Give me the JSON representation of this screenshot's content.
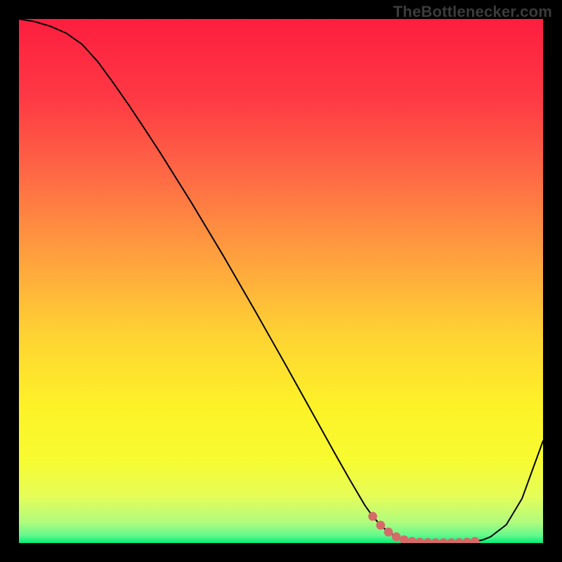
{
  "watermark": "TheBottlenecker.com",
  "chart_data": {
    "type": "line",
    "title": "",
    "xlabel": "",
    "ylabel": "",
    "xlim": [
      0,
      100
    ],
    "ylim": [
      0,
      100
    ],
    "grid": false,
    "x": [
      0,
      3,
      6,
      9,
      12,
      15,
      18,
      21,
      24,
      27,
      30,
      33,
      36,
      39,
      42,
      45,
      48,
      51,
      54,
      57,
      60,
      63,
      66,
      67.5,
      69,
      70.5,
      72,
      73.5,
      75,
      76.5,
      78,
      79.5,
      81,
      82.5,
      84,
      85.5,
      87,
      88.5,
      90,
      93,
      96,
      100
    ],
    "values": [
      100,
      99.5,
      98.6,
      97.3,
      95.2,
      91.9,
      87.8,
      83.5,
      79.0,
      74.4,
      69.6,
      64.8,
      59.8,
      54.8,
      49.6,
      44.4,
      39.1,
      33.8,
      28.4,
      23.0,
      17.6,
      12.3,
      7.2,
      5.1,
      3.4,
      2.1,
      1.2,
      0.6,
      0.3,
      0.15,
      0.08,
      0.05,
      0.05,
      0.05,
      0.08,
      0.15,
      0.3,
      0.6,
      1.2,
      3.5,
      8.5,
      19.5
    ],
    "marker_points_x": [
      67.5,
      69.0,
      70.5,
      72.0,
      73.5,
      75.0,
      76.5,
      78.0,
      79.5,
      81.0,
      82.5,
      84.0,
      85.5,
      87.0
    ],
    "marker_points_y": [
      5.1,
      3.4,
      2.1,
      1.2,
      0.6,
      0.3,
      0.15,
      0.08,
      0.05,
      0.05,
      0.05,
      0.08,
      0.15,
      0.3
    ],
    "gradient_stops": [
      {
        "offset": 0.0,
        "color": "#fd1e3f"
      },
      {
        "offset": 0.15,
        "color": "#fe3944"
      },
      {
        "offset": 0.3,
        "color": "#fe6a45"
      },
      {
        "offset": 0.45,
        "color": "#fe9f3e"
      },
      {
        "offset": 0.6,
        "color": "#fed233"
      },
      {
        "offset": 0.74,
        "color": "#fdf228"
      },
      {
        "offset": 0.84,
        "color": "#f7fb30"
      },
      {
        "offset": 0.91,
        "color": "#e6fd58"
      },
      {
        "offset": 0.96,
        "color": "#b1fb7d"
      },
      {
        "offset": 0.985,
        "color": "#66f98d"
      },
      {
        "offset": 1.0,
        "color": "#02ee77"
      }
    ],
    "line_color": "#000000",
    "marker_color": "#d66a68"
  }
}
